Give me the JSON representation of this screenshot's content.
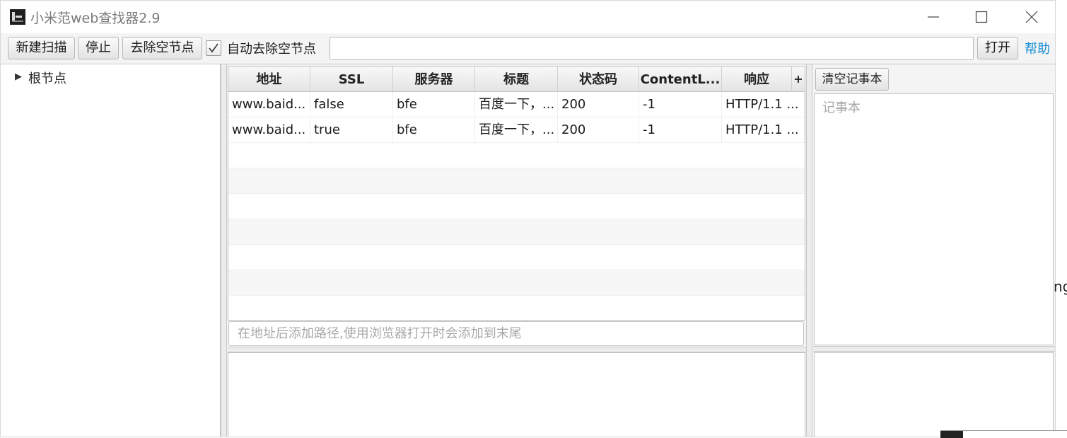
{
  "window": {
    "title": "小米范web查找器2.9"
  },
  "toolbar": {
    "new_scan": "新建扫描",
    "stop": "停止",
    "remove_empty": "去除空节点",
    "auto_remove_checked": true,
    "auto_remove_label": "自动去除空节点",
    "url_value": "",
    "open": "打开",
    "help": "帮助"
  },
  "tree": {
    "root_label": "根节点"
  },
  "table": {
    "columns": [
      "地址",
      "SSL",
      "服务器",
      "标题",
      "状态码",
      "ContentL...",
      "响应"
    ],
    "add_column": "+",
    "rows": [
      [
        "www.baid...",
        "false",
        "bfe",
        "百度一下，...",
        "200",
        "-1",
        "HTTP/1.1 ..."
      ],
      [
        "www.baid...",
        "true",
        "bfe",
        "百度一下，...",
        "200",
        "-1",
        "HTTP/1.1 ..."
      ]
    ]
  },
  "path_input": {
    "placeholder": "在地址后添加路径,使用浏览器打开时会添加到末尾"
  },
  "notes": {
    "clear_button": "清空记事本",
    "placeholder": "记事本"
  },
  "background": {
    "fragment": "ng"
  }
}
